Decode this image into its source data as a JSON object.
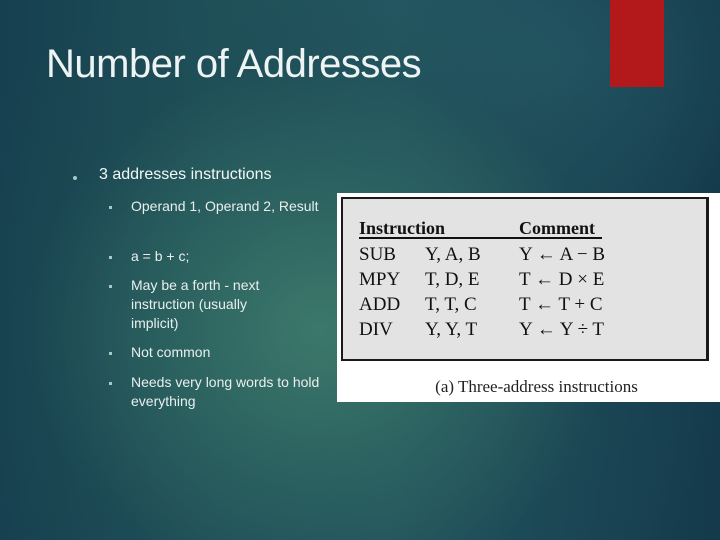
{
  "slide": {
    "title": "Number of Addresses",
    "accent_color": "#b3191b",
    "bullets": [
      {
        "label": "3 addresses instructions",
        "children": [
          {
            "label": "Operand 1, Operand 2, Result"
          },
          {
            "label": "a = b + c;"
          },
          {
            "label": "May be a forth - next instruction (usually implicit)"
          },
          {
            "label": "Not common"
          },
          {
            "label": "Needs very long words to hold everything"
          }
        ]
      }
    ]
  },
  "figure": {
    "headers": {
      "instruction": "Instruction",
      "comment": "Comment"
    },
    "rows": [
      {
        "op": "SUB",
        "args": "Y, A, B",
        "comment": "Y ← A − B"
      },
      {
        "op": "MPY",
        "args": "T, D, E",
        "comment": "T ← D × E"
      },
      {
        "op": "ADD",
        "args": "T, T, C",
        "comment": "T ← T + C"
      },
      {
        "op": "DIV",
        "args": "Y, Y, T",
        "comment": "Y ← Y ÷ T"
      }
    ],
    "caption": "(a) Three-address instructions"
  }
}
